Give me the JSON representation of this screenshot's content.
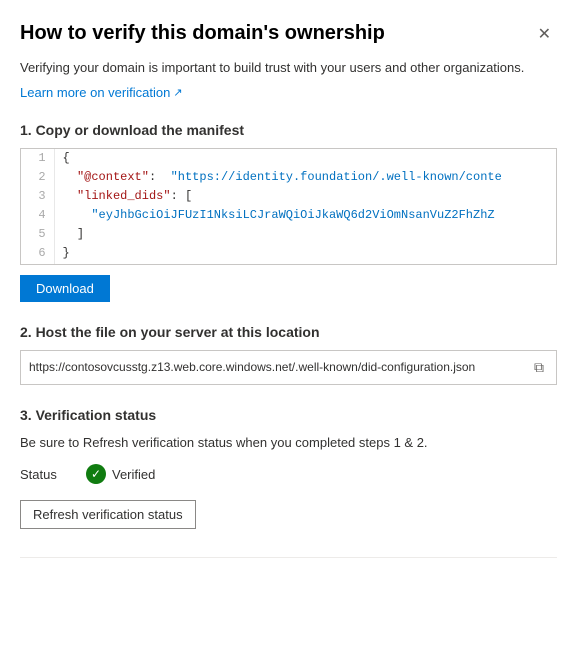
{
  "panel": {
    "title": "How to verify this domain's ownership",
    "close_label": "✕"
  },
  "intro": {
    "description": "Verifying your domain is important to build trust with your users and other organizations.",
    "learn_more_label": "Learn more on verification",
    "learn_more_icon": "↗"
  },
  "section1": {
    "title": "1. Copy or download the manifest",
    "code_lines": [
      {
        "num": "1",
        "content": "{"
      },
      {
        "num": "2",
        "content": "  \"@context\":  \"https://identity.foundation/.well-known/conte"
      },
      {
        "num": "3",
        "content": "  \"linked_dids\": ["
      },
      {
        "num": "4",
        "content": "    \"eyJhbGciOiJFUzI1NksiLCJraWQiOiJkaWQ6d2ViOmNsanVuZ2FhZhZ"
      },
      {
        "num": "5",
        "content": "  ]"
      },
      {
        "num": "6",
        "content": "}"
      }
    ],
    "download_label": "Download"
  },
  "section2": {
    "title": "2. Host the file on your server at this location",
    "url": "https://contosovcusstg.z13.web.core.windows.net/.well-known/did-configuration.json",
    "copy_icon": "⧉"
  },
  "section3": {
    "title": "3. Verification status",
    "description": "Be sure to Refresh verification status when you completed steps 1 & 2.",
    "status_label": "Status",
    "verified_label": "Verified",
    "refresh_label": "Refresh verification status"
  }
}
